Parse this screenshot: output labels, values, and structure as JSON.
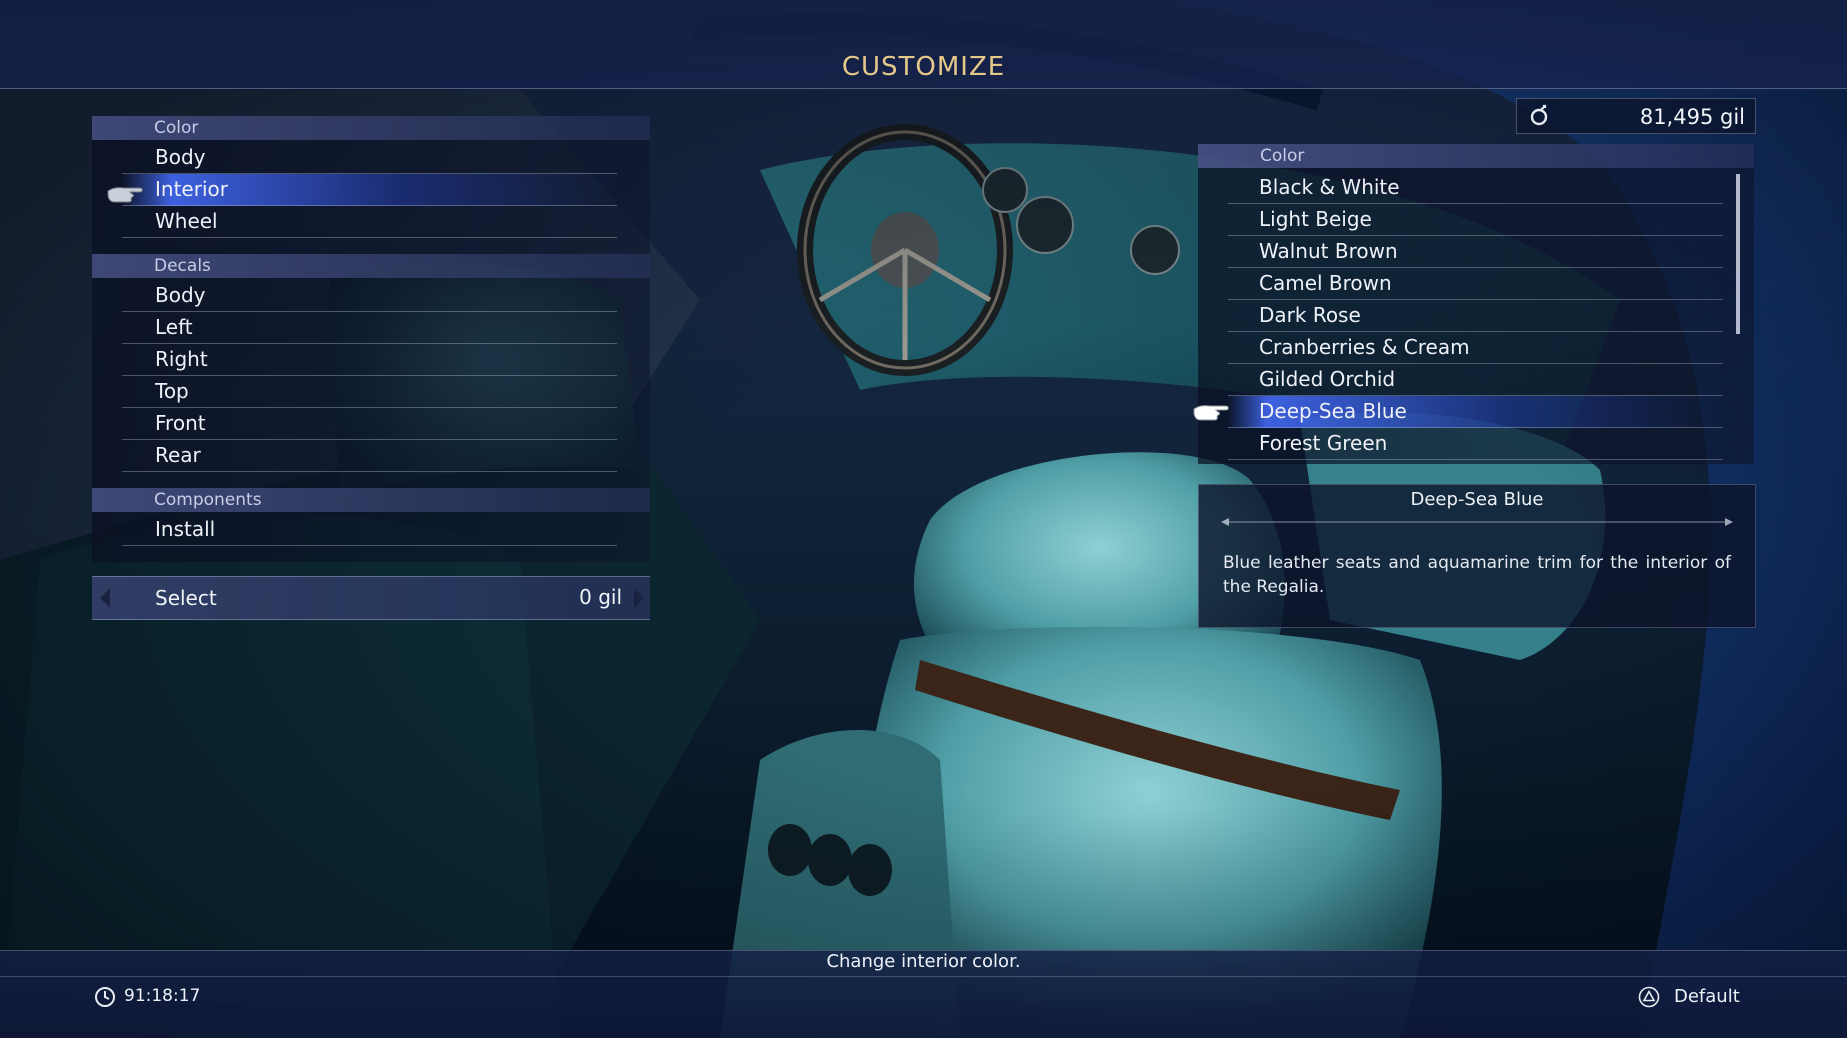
{
  "header": {
    "title": "CUSTOMIZE"
  },
  "wallet": {
    "amount": "81,495",
    "unit": "gil",
    "icon": "gil-currency-icon"
  },
  "left_menu": {
    "sections": [
      {
        "header": "Color",
        "items": [
          "Body",
          "Interior",
          "Wheel"
        ]
      },
      {
        "header": "Decals",
        "items": [
          "Body",
          "Left",
          "Right",
          "Top",
          "Front",
          "Rear"
        ]
      },
      {
        "header": "Components",
        "items": [
          "Install"
        ]
      }
    ],
    "selected_item": "Interior",
    "select_bar": {
      "label": "Select",
      "price": "0 gil"
    }
  },
  "color_list": {
    "header": "Color",
    "items": [
      "Black & White",
      "Light Beige",
      "Walnut Brown",
      "Camel Brown",
      "Dark Rose",
      "Cranberries & Cream",
      "Gilded Orchid",
      "Deep-Sea Blue",
      "Forest Green"
    ],
    "selected_item": "Deep-Sea Blue"
  },
  "description": {
    "title": "Deep-Sea Blue",
    "text": "Blue leather seats and aquamarine trim for the interior of the Regalia."
  },
  "footer": {
    "help_text": "Change interior color.",
    "playtime": "91:18:17",
    "playtime_icon": "clock-icon",
    "default_button": {
      "icon": "triangle-button-icon",
      "label": "Default"
    }
  },
  "colors": {
    "title_gold": "#e6c98a",
    "highlight_blue": "#466eff",
    "panel_navy": "#0c142a"
  }
}
